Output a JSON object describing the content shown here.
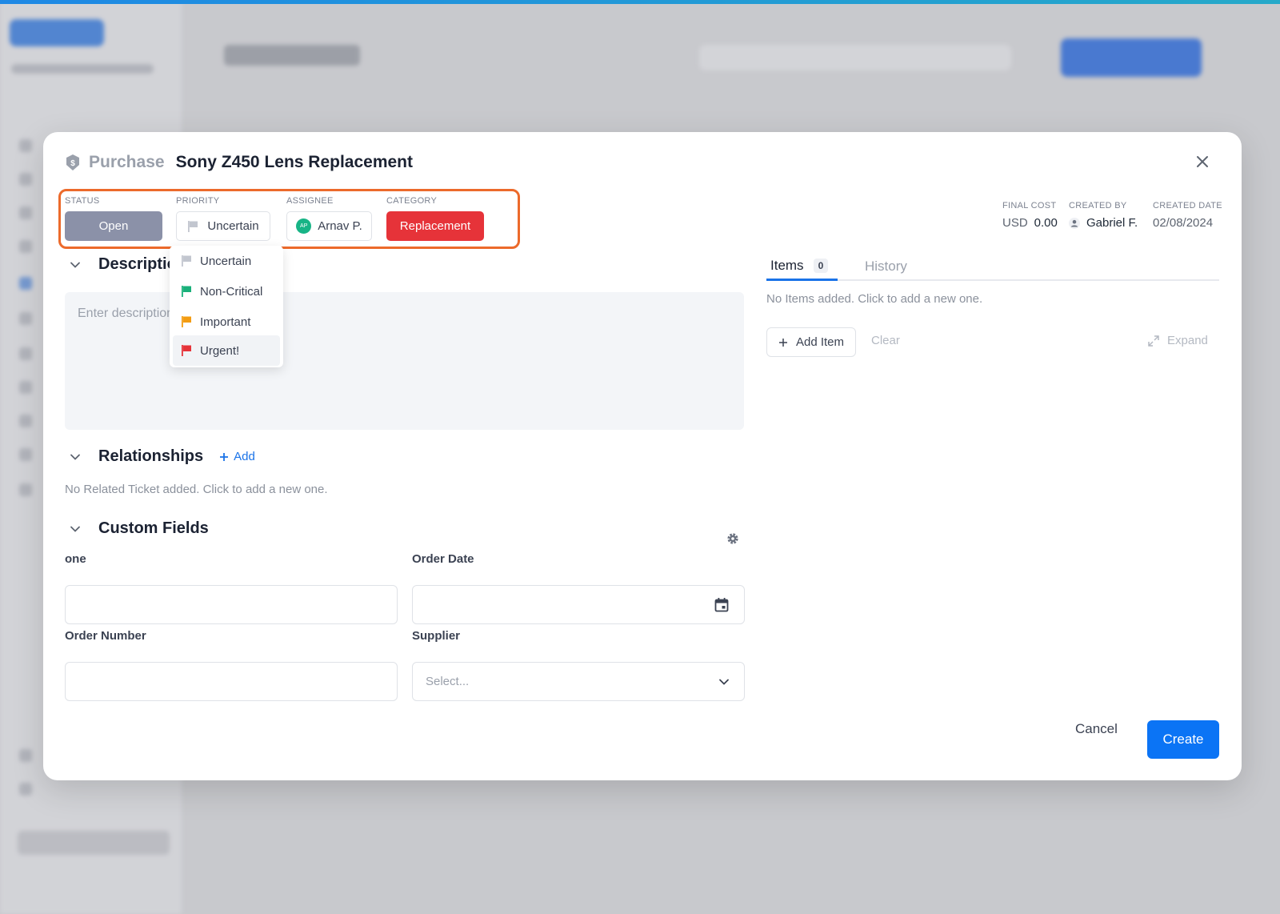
{
  "modal": {
    "type_label": "Purchase",
    "title": "Sony Z450 Lens Replacement"
  },
  "properties": {
    "status": {
      "label": "STATUS",
      "value": "Open"
    },
    "priority": {
      "label": "PRIORITY",
      "value": "Uncertain"
    },
    "assignee": {
      "label": "ASSIGNEE",
      "initials": "AP",
      "value": "Arnav P."
    },
    "category": {
      "label": "CATEGORY",
      "value": "Replacement"
    }
  },
  "meta": {
    "final_cost": {
      "label": "FINAL COST",
      "currency": "USD",
      "value": "0.00"
    },
    "created_by": {
      "label": "CREATED BY",
      "value": "Gabriel F."
    },
    "created_date": {
      "label": "CREATED DATE",
      "value": "02/08/2024"
    }
  },
  "priority_dropdown": {
    "options": [
      {
        "label": "Uncertain",
        "color": "#c2c6cf"
      },
      {
        "label": "Non-Critical",
        "color": "#19b07a"
      },
      {
        "label": "Important",
        "color": "#f39c12"
      },
      {
        "label": "Urgent!",
        "color": "#e63339"
      }
    ]
  },
  "description": {
    "title": "Description",
    "placeholder": "Enter description"
  },
  "relationships": {
    "title": "Relationships",
    "add_label": "Add",
    "empty_text": "No Related Ticket added. Click to add a new one."
  },
  "custom_fields": {
    "title": "Custom Fields",
    "fields": {
      "one": {
        "label": "one"
      },
      "order_date": {
        "label": "Order Date"
      },
      "order_number": {
        "label": "Order Number"
      },
      "supplier": {
        "label": "Supplier",
        "placeholder": "Select..."
      }
    }
  },
  "tabs": {
    "items": {
      "label": "Items",
      "count": "0"
    },
    "history": {
      "label": "History"
    }
  },
  "items_panel": {
    "empty_text": "No Items added. Click to add a new one.",
    "add_item_label": "Add Item",
    "clear_label": "Clear",
    "expand_label": "Expand"
  },
  "footer": {
    "cancel_label": "Cancel",
    "create_label": "Create"
  },
  "colors": {
    "accent": "#0b74f5",
    "status": "#8b91a8",
    "category": "#e63339",
    "highlight_box": "#ec6a2b"
  }
}
